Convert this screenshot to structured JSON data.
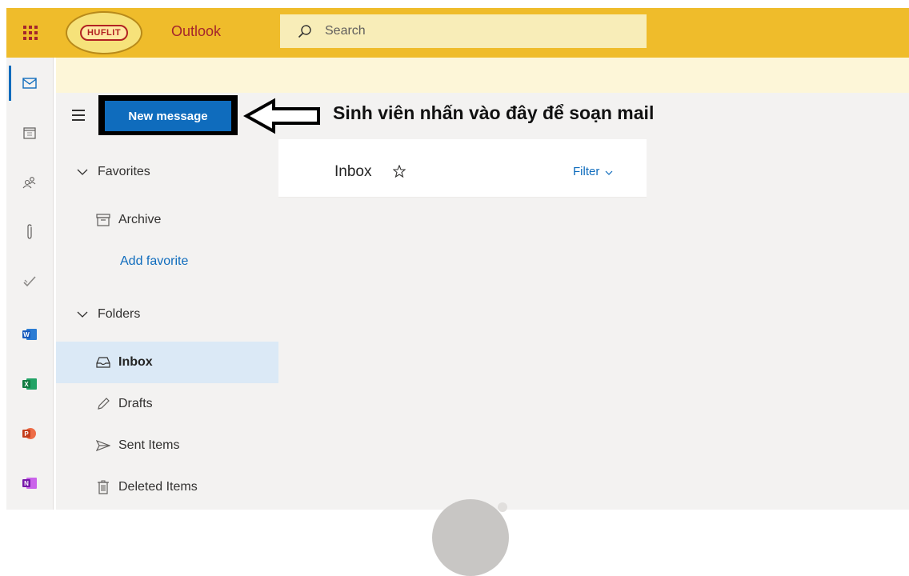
{
  "header": {
    "logo_text": "HUFLIT",
    "app_name": "Outlook",
    "search_placeholder": "Search"
  },
  "rail": {
    "items": [
      "mail-icon",
      "calendar-icon",
      "people-icon",
      "attachment-icon",
      "todo-icon",
      "word-icon",
      "excel-icon",
      "powerpoint-icon",
      "onenote-icon"
    ],
    "office_letters": {
      "word": "W",
      "excel": "X",
      "powerpoint": "P",
      "onenote": "N"
    }
  },
  "command_bar": {
    "new_message_label": "New message",
    "annotation_text": "Sinh viên nhấn vào đây để soạn mail"
  },
  "folders": {
    "favorites_label": "Favorites",
    "archive_label": "Archive",
    "add_favorite_label": "Add favorite",
    "folders_label": "Folders",
    "inbox_label": "Inbox",
    "drafts_label": "Drafts",
    "sent_label": "Sent Items",
    "deleted_label": "Deleted Items"
  },
  "message_list": {
    "title": "Inbox",
    "filter_label": "Filter"
  },
  "colors": {
    "header": "#efbc2b",
    "accent": "#0f6cbd",
    "app_name": "#a4262c",
    "selected_folder": "#dbe9f6"
  }
}
